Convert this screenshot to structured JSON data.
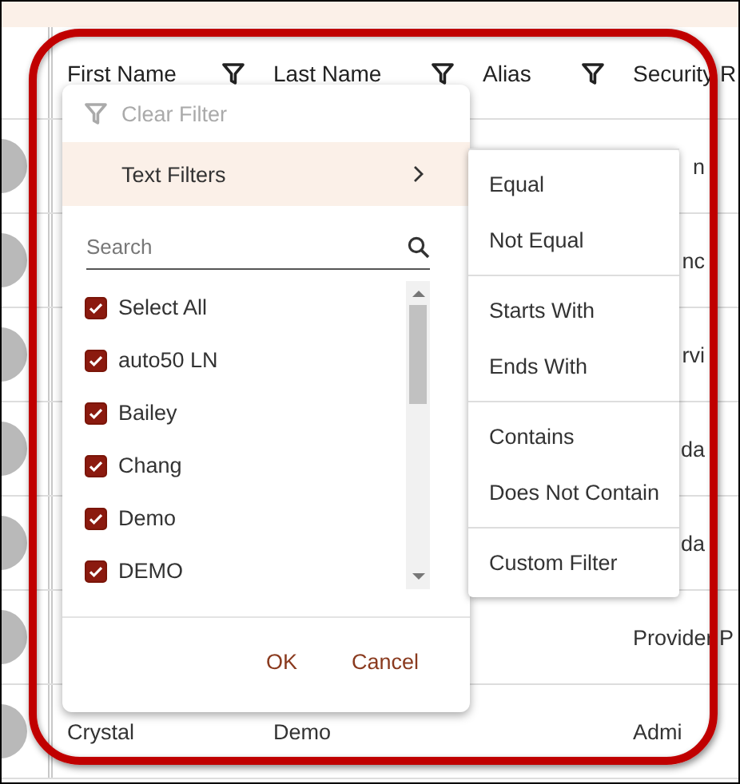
{
  "table": {
    "columns": [
      {
        "label": "First Name",
        "has_filter": true
      },
      {
        "label": "Last Name",
        "has_filter": true
      },
      {
        "label": "Alias",
        "has_filter": true
      },
      {
        "label": "Security R",
        "has_filter": false
      }
    ],
    "rows": [
      {
        "kind": "partial",
        "security_role": "n"
      },
      {
        "kind": "partial",
        "security_role": "nc"
      },
      {
        "kind": "partial",
        "security_role": "rvi"
      },
      {
        "kind": "partial",
        "security_role": "da"
      },
      {
        "kind": "partial",
        "security_role": "da"
      },
      {
        "kind": "full",
        "security_role": "Provider P"
      },
      {
        "kind": "full",
        "first_name": "Crystal",
        "last_name": "Demo",
        "security_role": "Admi"
      }
    ]
  },
  "filter_menu": {
    "clear_filter": {
      "label": "Clear Filter",
      "disabled": true
    },
    "text_filters": {
      "label": "Text Filters",
      "highlighted": true
    },
    "search": {
      "placeholder": "Search"
    },
    "items": [
      {
        "label": "Select All",
        "checked": true
      },
      {
        "label": "auto50 LN",
        "checked": true
      },
      {
        "label": "Bailey",
        "checked": true
      },
      {
        "label": "Chang",
        "checked": true
      },
      {
        "label": "Demo",
        "checked": true
      },
      {
        "label": "DEMO",
        "checked": true
      }
    ],
    "buttons": [
      {
        "label": "OK"
      },
      {
        "label": "Cancel"
      }
    ]
  },
  "text_filter_submenu": {
    "groups": [
      [
        "Equal",
        "Not Equal"
      ],
      [
        "Starts With",
        "Ends With"
      ],
      [
        "Contains",
        "Does Not Contain"
      ],
      [
        "Custom Filter"
      ]
    ]
  }
}
